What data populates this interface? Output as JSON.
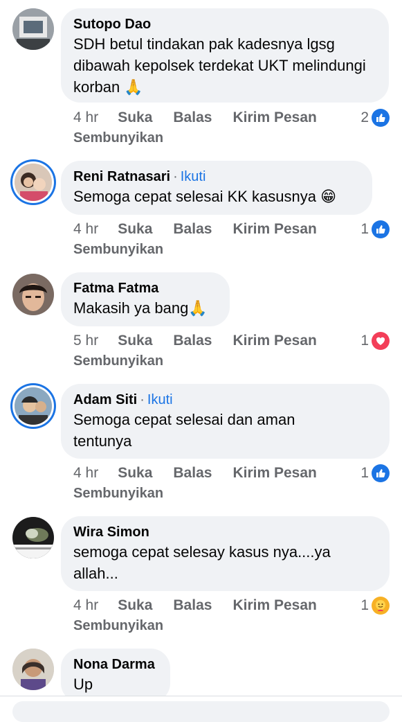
{
  "actions": {
    "like": "Suka",
    "reply": "Balas",
    "message": "Kirim Pesan",
    "hide": "Sembunyikan",
    "follow": "Ikuti",
    "dot": "·"
  },
  "comments": [
    {
      "name": "Sutopo Dao",
      "text": "SDH betul tindakan pak kadesnya lgsg dibawah kepolsek terdekat UKT melindungi korban 🙏",
      "time": "4 hr",
      "reactions": "2",
      "reaction_type": "like"
    },
    {
      "name": "Reni Ratnasari",
      "text": "Semoga cepat selesai KK kasusnya 😁",
      "time": "4 hr",
      "reactions": "1",
      "reaction_type": "like"
    },
    {
      "name": "Fatma Fatma",
      "text": "Makasih ya bang🙏",
      "time": "5 hr",
      "reactions": "1",
      "reaction_type": "love"
    },
    {
      "name": "Adam Siti",
      "text": "Semoga cepat selesai dan aman tentunya",
      "time": "4 hr",
      "reactions": "1",
      "reaction_type": "like"
    },
    {
      "name": "Wira Simon",
      "text": "semoga cepat selesay kasus nya....ya allah...",
      "time": "4 hr",
      "reactions": "1",
      "reaction_type": "care"
    },
    {
      "name": "Nona Darma",
      "text": "Up"
    }
  ],
  "colors": {
    "accent": "#1b74e4",
    "bubble": "#f0f2f5",
    "muted": "#65676b",
    "love": "#f33e58",
    "care": "#f7b125"
  }
}
